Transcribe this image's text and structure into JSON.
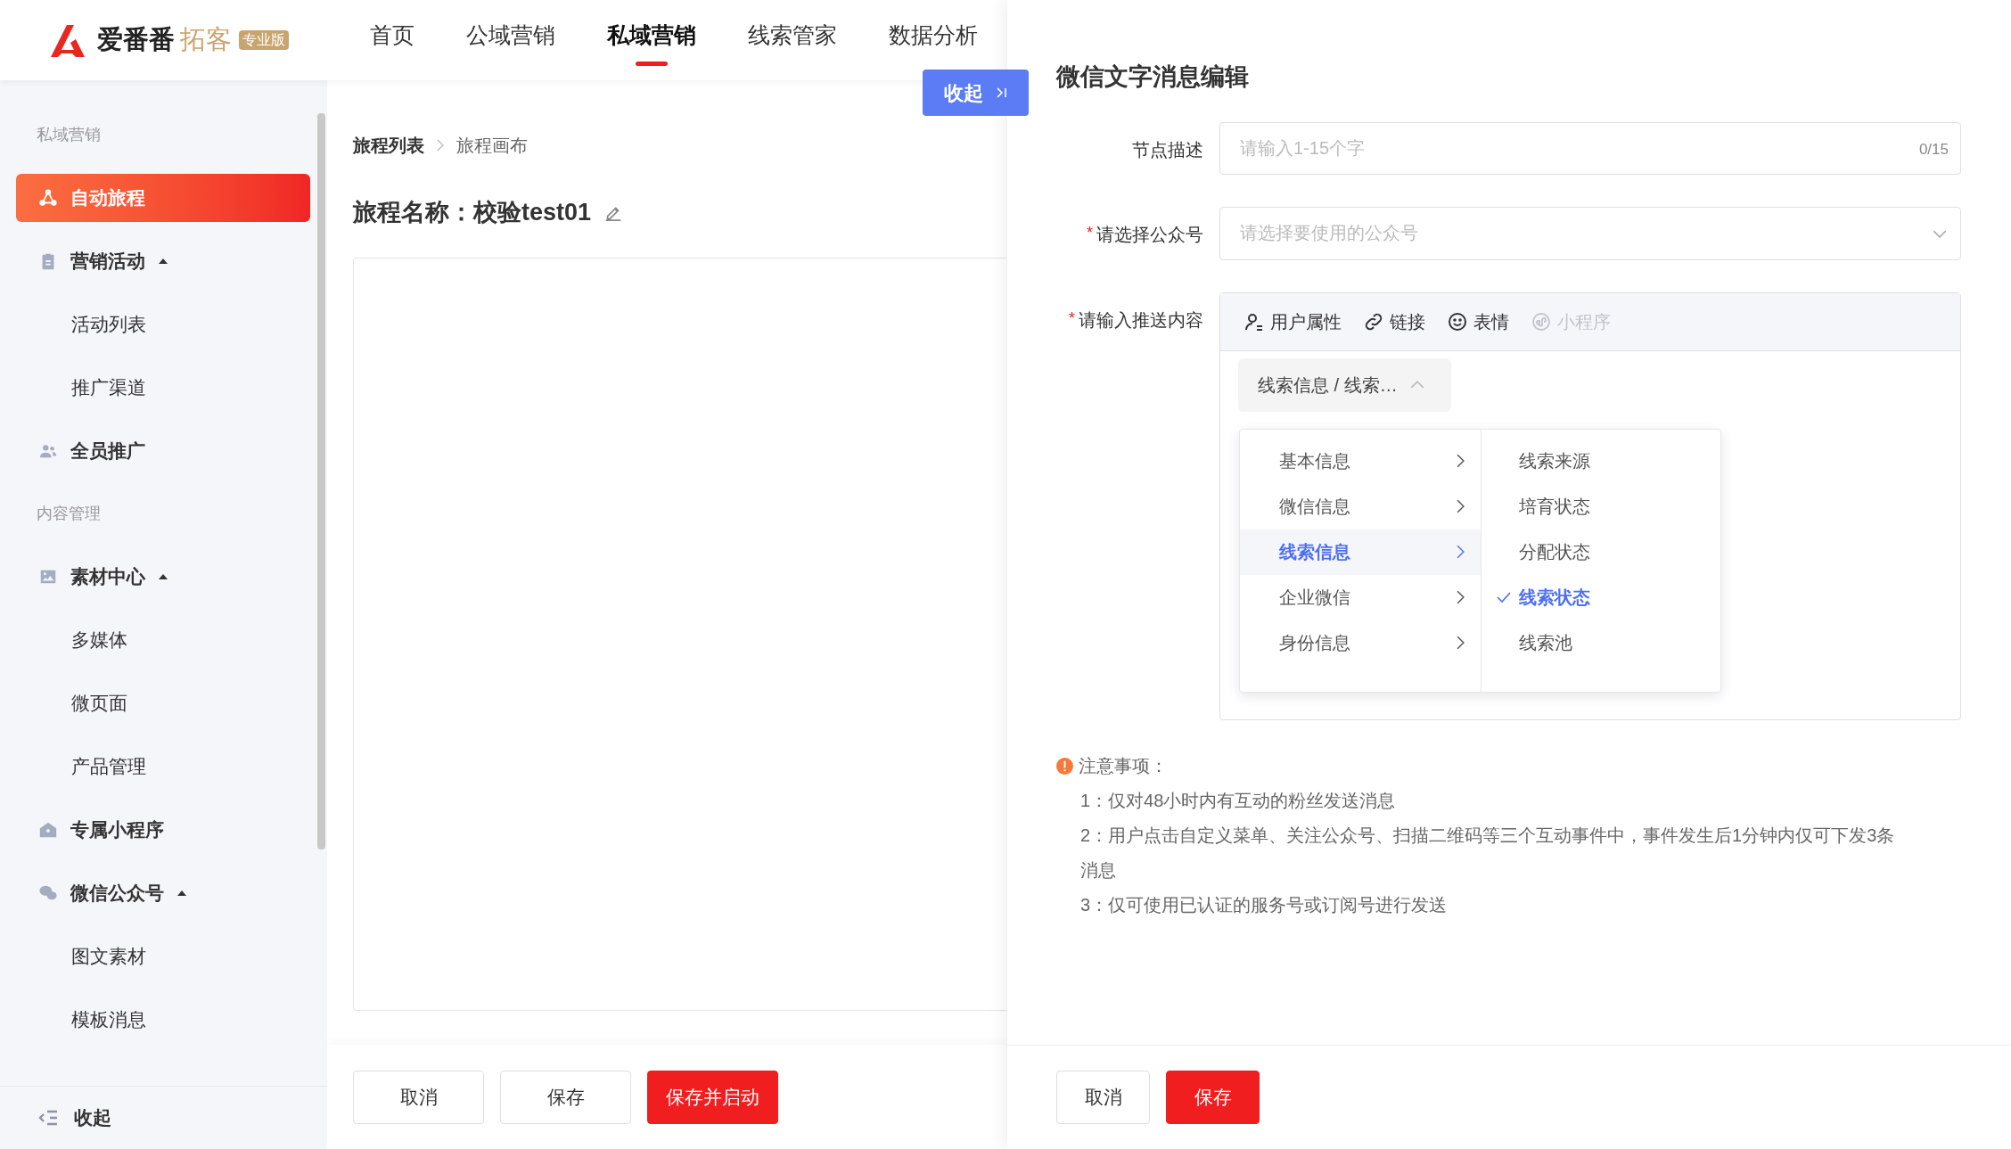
{
  "header": {
    "logo": {
      "name": "爱番番",
      "product": "拓客",
      "badge": "专业版"
    },
    "nav": [
      {
        "label": "首页",
        "selected": false
      },
      {
        "label": "公域营销",
        "selected": false
      },
      {
        "label": "私域营销",
        "selected": true
      },
      {
        "label": "线索管家",
        "selected": false
      },
      {
        "label": "数据分析",
        "selected": false
      }
    ]
  },
  "sidebar": {
    "items": [
      {
        "kind": "section",
        "label": "私域营销"
      },
      {
        "kind": "link",
        "label": "自动旅程",
        "selected": true
      },
      {
        "kind": "group",
        "label": "营销活动",
        "expanded": true,
        "children": [
          {
            "label": "活动列表",
            "selected": false
          },
          {
            "label": "推广渠道",
            "selected": false
          }
        ]
      },
      {
        "kind": "link",
        "label": "全员推广",
        "selected": false
      },
      {
        "kind": "section",
        "label": "内容管理"
      },
      {
        "kind": "group",
        "label": "素材中心",
        "expanded": true,
        "children": [
          {
            "label": "多媒体",
            "selected": false
          },
          {
            "label": "微页面",
            "selected": false
          },
          {
            "label": "产品管理",
            "selected": false
          }
        ]
      },
      {
        "kind": "link",
        "label": "专属小程序",
        "selected": false
      },
      {
        "kind": "group",
        "label": "微信公众号",
        "expanded": true,
        "children": [
          {
            "label": "图文素材",
            "selected": false
          },
          {
            "label": "模板消息",
            "selected": false
          }
        ]
      }
    ],
    "collapse": "收起"
  },
  "main": {
    "breadcrumb": [
      "旅程列表",
      "旅程画布"
    ],
    "title": "旅程名称：校验test01",
    "buttons": [
      {
        "label": "取消",
        "kind": "default"
      },
      {
        "label": "保存",
        "kind": "default"
      },
      {
        "label": "保存并启动",
        "kind": "primary"
      }
    ]
  },
  "drawer": {
    "collapse_button": "收起",
    "title": "微信文字消息编辑",
    "required_mark": "*",
    "fields": [
      {
        "kind": "text",
        "label": "节点描述",
        "required": false,
        "placeholder": "请输入1-15个字",
        "counter": "0/15"
      },
      {
        "kind": "select",
        "label": "请选择公众号",
        "required": true,
        "placeholder": "请选择要使用的公众号"
      },
      {
        "kind": "editor",
        "label": "请输入推送内容",
        "required": true,
        "toolbar": [
          {
            "kind": "user",
            "label": "用户属性",
            "disabled": false
          },
          {
            "kind": "link",
            "label": "链接",
            "disabled": false
          },
          {
            "kind": "emoji",
            "label": "表情",
            "disabled": false
          },
          {
            "kind": "miniapp",
            "label": "小程序",
            "disabled": true
          }
        ],
        "tag": "线索信息 / 线索…",
        "cascader": {
          "left": [
            {
              "label": "基本信息",
              "selected": false
            },
            {
              "label": "微信信息",
              "selected": false
            },
            {
              "label": "线索信息",
              "selected": true
            },
            {
              "label": "企业微信",
              "selected": false
            },
            {
              "label": "身份信息",
              "selected": false
            }
          ],
          "right": [
            {
              "label": "线索来源",
              "selected": false
            },
            {
              "label": "培育状态",
              "selected": false
            },
            {
              "label": "分配状态",
              "selected": false
            },
            {
              "label": "线索状态",
              "selected": true
            },
            {
              "label": "线索池",
              "selected": false
            }
          ]
        }
      }
    ],
    "notes": {
      "title": "注意事项：",
      "items": [
        "1：仅对48小时内有互动的粉丝发送消息",
        "2：用户点击自定义菜单、关注公众号、扫描二维码等三个互动事件中，事件发生后1分钟内仅可下发3条消息",
        "3：仅可使用已认证的服务号或订阅号进行发送"
      ]
    },
    "buttons": [
      {
        "label": "取消",
        "kind": "default"
      },
      {
        "label": "保存",
        "kind": "primary"
      }
    ]
  }
}
